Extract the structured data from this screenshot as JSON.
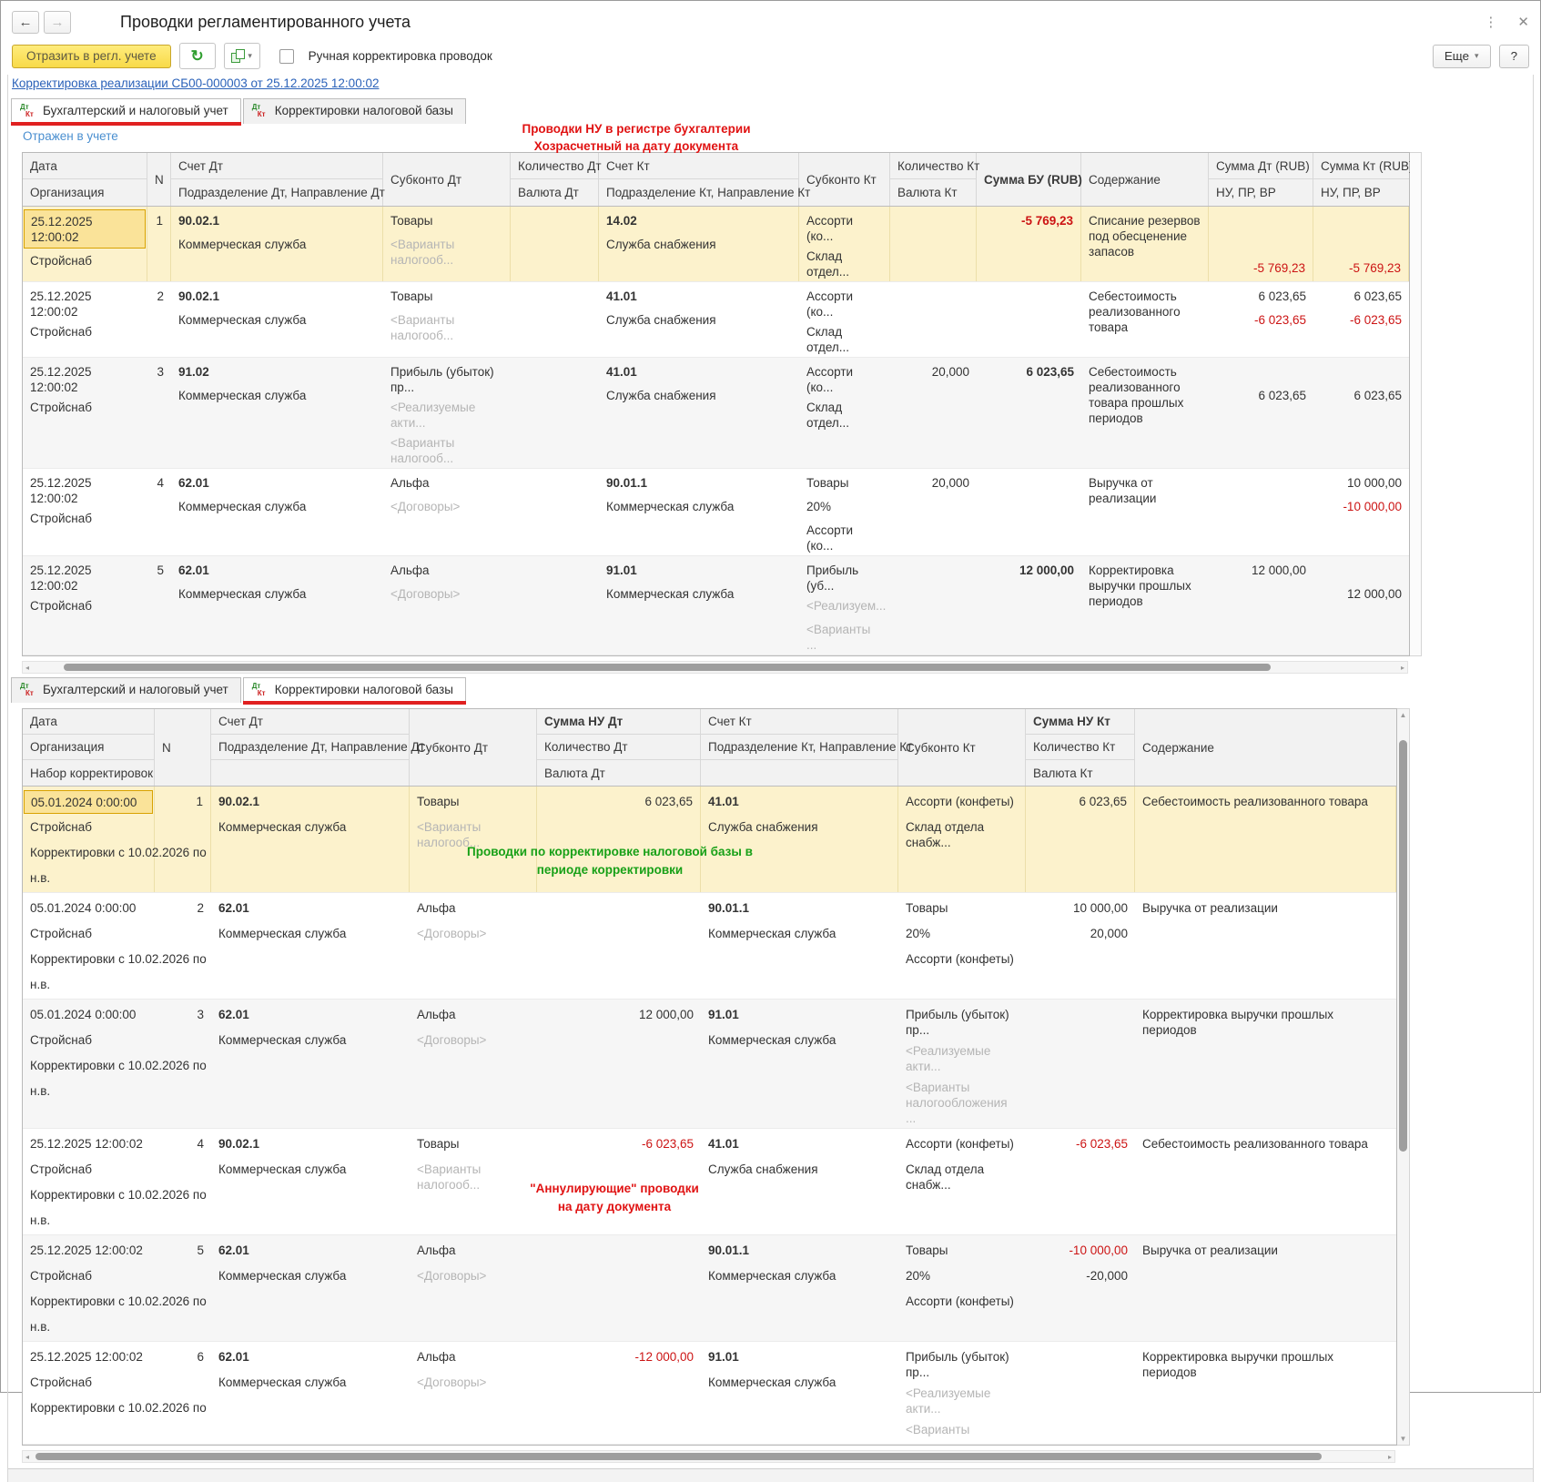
{
  "window": {
    "title": "Проводки регламентированного учета"
  },
  "toolbar": {
    "reflect_button": "Отразить в регл. учете",
    "manual_adjustment_label": "Ручная корректировка проводок",
    "more_button": "Еще",
    "help_button": "?"
  },
  "document_link": "Корректировка реализации СБ00-000003 от 25.12.2025 12:00:02",
  "status_link": "Отражен в учете",
  "tab_icon": {
    "dt": "Дт",
    "kt": "Кт"
  },
  "tabs": {
    "accounting": "Бухгалтерский и налоговый учет",
    "tax_base": "Корректировки налоговой базы"
  },
  "annotations": {
    "top_red": [
      "Проводки НУ в регистре бухгалтерии",
      "Хозрасчетный на дату документа"
    ],
    "green": [
      "Проводки по корректировке налоговой базы в",
      "периоде корректировки"
    ],
    "bottom_red": [
      "\"Аннулирующие\" проводки",
      "на дату документа"
    ]
  },
  "table1": {
    "header": [
      [
        {
          "t": "Дата",
          "r": 1
        },
        {
          "t": "Организация",
          "r": 1
        }
      ],
      [
        {
          "t": "N",
          "r": 2
        }
      ],
      [
        {
          "t": "Счет Дт",
          "r": 1
        },
        {
          "t": "Подразделение Дт, Направление Дт",
          "r": 1
        }
      ],
      [
        {
          "t": "Субконто Дт",
          "r": 2
        }
      ],
      [
        {
          "t": "Количество Дт",
          "r": 1
        },
        {
          "t": "Валюта Дт",
          "r": 1
        }
      ],
      [
        {
          "t": "Счет Кт",
          "r": 1
        },
        {
          "t": "Подразделение Кт, Направление Кт",
          "r": 1
        }
      ],
      [
        {
          "t": "Субконто Кт",
          "r": 2
        }
      ],
      [
        {
          "t": "Количество Кт",
          "r": 1
        },
        {
          "t": "Валюта Кт",
          "r": 1
        }
      ],
      [
        {
          "t": "Сумма БУ (RUB)",
          "r": 2,
          "b": 1
        }
      ],
      [
        {
          "t": "Содержание",
          "r": 2
        }
      ],
      [
        {
          "t": "Сумма Дт (RUB)",
          "r": 1
        },
        {
          "t": "НУ, ПР, ВР",
          "r": 1
        }
      ],
      [
        {
          "t": "Сумма Кт (RUB)",
          "r": 1
        },
        {
          "t": "НУ, ПР, ВР",
          "r": 1
        }
      ]
    ],
    "groups": [
      {
        "box": null,
        "rows": [
          {
            "bg": "sel",
            "selected": true,
            "cells": {
              "date": [
                "25.12.2025 12:00:02",
                "Стройснаб"
              ],
              "n": [
                "1"
              ],
              "acct_dt": [
                {
                  "t": "90.02.1",
                  "s": "b"
                },
                "Коммерческая служба"
              ],
              "sub_dt": [
                "Товары",
                {
                  "t": "<Варианты налогооб...",
                  "s": "g"
                }
              ],
              "qty_dt": [],
              "acct_kt": [
                {
                  "t": "14.02",
                  "s": "b"
                },
                "Служба снабжения"
              ],
              "sub_kt": [
                "Ассорти (ко...",
                "Склад отдел..."
              ],
              "qty_kt": [],
              "sum_bu": [
                {
                  "t": "-5 769,23",
                  "s": "rb"
                }
              ],
              "content": [
                "Списание резервов под обесценение запасов"
              ],
              "sum_dt": [
                null,
                null,
                {
                  "t": "-5 769,23",
                  "s": "r"
                }
              ],
              "sum_kt": [
                null,
                null,
                {
                  "t": "-5 769,23",
                  "s": "r"
                }
              ]
            }
          }
        ]
      },
      {
        "box": "red",
        "rows": [
          {
            "bg": "",
            "cells": {
              "date": [
                "25.12.2025 12:00:02",
                "Стройснаб"
              ],
              "n": [
                "2"
              ],
              "acct_dt": [
                {
                  "t": "90.02.1",
                  "s": "b"
                },
                "Коммерческая служба"
              ],
              "sub_dt": [
                "Товары",
                {
                  "t": "<Варианты налогооб...",
                  "s": "g"
                }
              ],
              "acct_kt": [
                {
                  "t": "41.01",
                  "s": "b"
                },
                "Служба снабжения"
              ],
              "sub_kt": [
                "Ассорти (ко...",
                "Склад отдел..."
              ],
              "content": [
                "Себестоимость реализованного товара"
              ],
              "sum_dt": [
                "6 023,65",
                {
                  "t": "-6 023,65",
                  "s": "r"
                }
              ],
              "sum_kt": [
                "6 023,65",
                {
                  "t": "-6 023,65",
                  "s": "r"
                }
              ]
            }
          }
        ]
      },
      {
        "box": null,
        "rows": [
          {
            "bg": "alt",
            "cells": {
              "date": [
                "25.12.2025 12:00:02",
                "Стройснаб"
              ],
              "n": [
                "3"
              ],
              "acct_dt": [
                {
                  "t": "91.02",
                  "s": "b"
                },
                "Коммерческая служба"
              ],
              "sub_dt": [
                "Прибыль (убыток) пр...",
                {
                  "t": "<Реализуемые акти...",
                  "s": "g"
                },
                {
                  "t": "<Варианты налогооб...",
                  "s": "g"
                }
              ],
              "acct_kt": [
                {
                  "t": "41.01",
                  "s": "b"
                },
                "Служба снабжения"
              ],
              "sub_kt": [
                "Ассорти (ко...",
                "Склад отдел..."
              ],
              "qty_kt": [
                "20,000"
              ],
              "sum_bu": [
                {
                  "t": "6 023,65",
                  "s": "b"
                }
              ],
              "content": [
                "Себестоимость реализованного товара прошлых периодов"
              ],
              "sum_dt": [
                null,
                "6 023,65"
              ],
              "sum_kt": [
                null,
                "6 023,65"
              ]
            }
          }
        ]
      },
      {
        "box": "red",
        "rows": [
          {
            "bg": "",
            "cells": {
              "date": [
                "25.12.2025 12:00:02",
                "Стройснаб"
              ],
              "n": [
                "4"
              ],
              "acct_dt": [
                {
                  "t": "62.01",
                  "s": "b"
                },
                "Коммерческая служба"
              ],
              "sub_dt": [
                "Альфа",
                {
                  "t": "<Договоры>",
                  "s": "g"
                }
              ],
              "acct_kt": [
                {
                  "t": "90.01.1",
                  "s": "b"
                },
                "Коммерческая служба"
              ],
              "sub_kt": [
                "Товары",
                "20%",
                "Ассорти (ко..."
              ],
              "qty_kt": [
                "20,000"
              ],
              "content": [
                "Выручка от реализации"
              ],
              "sum_kt": [
                "10 000,00",
                {
                  "t": "-10 000,00",
                  "s": "r"
                }
              ]
            }
          },
          {
            "bg": "alt",
            "cells": {
              "date": [
                "25.12.2025 12:00:02",
                "Стройснаб"
              ],
              "n": [
                "5"
              ],
              "acct_dt": [
                {
                  "t": "62.01",
                  "s": "b"
                },
                "Коммерческая служба"
              ],
              "sub_dt": [
                "Альфа",
                {
                  "t": "<Договоры>",
                  "s": "g"
                }
              ],
              "acct_kt": [
                {
                  "t": "91.01",
                  "s": "b"
                },
                "Коммерческая служба"
              ],
              "sub_kt": [
                "Прибыль (уб...",
                {
                  "t": "<Реализуем...",
                  "s": "g"
                },
                {
                  "t": "<Варианты ...",
                  "s": "g"
                }
              ],
              "sum_bu": [
                {
                  "t": "12 000,00",
                  "s": "b"
                }
              ],
              "content": [
                "Корректировка выручки прошлых периодов"
              ],
              "sum_dt": [
                "12 000,00"
              ],
              "sum_kt": [
                null,
                "12 000,00"
              ]
            }
          }
        ]
      }
    ]
  },
  "table2": {
    "header": [
      [
        {
          "t": "Дата",
          "r": 1
        },
        {
          "t": "Организация",
          "r": 1
        },
        {
          "t": "Набор корректировок",
          "r": 1
        }
      ],
      [
        {
          "t": "N",
          "r": 3
        }
      ],
      [
        {
          "t": "Счет Дт",
          "r": 1
        },
        {
          "t": "Подразделение Дт, Направление Дт",
          "r": 1
        },
        {
          "t": "",
          "r": 1
        }
      ],
      [
        {
          "t": "Субконто Дт",
          "r": 3
        }
      ],
      [
        {
          "t": "Сумма НУ Дт",
          "r": 1,
          "b": 1
        },
        {
          "t": "Количество Дт",
          "r": 1
        },
        {
          "t": "Валюта Дт",
          "r": 1
        }
      ],
      [
        {
          "t": "Счет Кт",
          "r": 1
        },
        {
          "t": "Подразделение Кт, Направление Кт",
          "r": 1
        },
        {
          "t": "",
          "r": 1
        }
      ],
      [
        {
          "t": "Субконто Кт",
          "r": 3
        }
      ],
      [
        {
          "t": "Сумма НУ Кт",
          "r": 1,
          "b": 1
        },
        {
          "t": "Количество Кт",
          "r": 1
        },
        {
          "t": "Валюта Кт",
          "r": 1
        }
      ],
      [
        {
          "t": "Содержание",
          "r": 3
        }
      ]
    ],
    "groups": [
      {
        "box": "green",
        "rows": [
          {
            "bg": "sel",
            "selected": true,
            "ann": "green",
            "cells": {
              "date": [
                "05.01.2024 0:00:00",
                "Стройснаб",
                "Корректировки с 10.02.2026 по",
                "н.в."
              ],
              "n": [
                "1"
              ],
              "acct_dt": [
                {
                  "t": "90.02.1",
                  "s": "b"
                },
                "Коммерческая служба"
              ],
              "sub_dt": [
                "Товары",
                {
                  "t": "<Варианты налогооб...",
                  "s": "g"
                }
              ],
              "sum_nu_dt": [
                "6 023,65"
              ],
              "acct_kt": [
                {
                  "t": "41.01",
                  "s": "b"
                },
                "Служба снабжения"
              ],
              "sub_kt": [
                "Ассорти (конфеты)",
                "Склад отдела снабж..."
              ],
              "sum_nu_kt": [
                "6 023,65"
              ],
              "content": [
                "Себестоимость реализованного товара"
              ]
            }
          },
          {
            "bg": "",
            "cells": {
              "date": [
                "05.01.2024 0:00:00",
                "Стройснаб",
                "Корректировки с 10.02.2026 по",
                "н.в."
              ],
              "n": [
                "2"
              ],
              "acct_dt": [
                {
                  "t": "62.01",
                  "s": "b"
                },
                "Коммерческая служба"
              ],
              "sub_dt": [
                "Альфа",
                {
                  "t": "<Договоры>",
                  "s": "g"
                }
              ],
              "acct_kt": [
                {
                  "t": "90.01.1",
                  "s": "b"
                },
                "Коммерческая служба"
              ],
              "sub_kt": [
                "Товары",
                "20%",
                "Ассорти (конфеты)"
              ],
              "sum_nu_kt": [
                "10 000,00",
                "20,000"
              ],
              "content": [
                "Выручка от реализации"
              ]
            }
          },
          {
            "bg": "alt",
            "cells": {
              "date": [
                "05.01.2024 0:00:00",
                "Стройснаб",
                "Корректировки с 10.02.2026 по",
                "н.в."
              ],
              "n": [
                "3"
              ],
              "acct_dt": [
                {
                  "t": "62.01",
                  "s": "b"
                },
                "Коммерческая служба"
              ],
              "sub_dt": [
                "Альфа",
                {
                  "t": "<Договоры>",
                  "s": "g"
                }
              ],
              "sum_nu_dt": [
                "12 000,00"
              ],
              "acct_kt": [
                {
                  "t": "91.01",
                  "s": "b"
                },
                "Коммерческая служба"
              ],
              "sub_kt": [
                "Прибыль (убыток) пр...",
                {
                  "t": "<Реализуемые акти...",
                  "s": "g"
                },
                {
                  "t": "<Варианты налогообложения ...",
                  "s": "g"
                }
              ],
              "content": [
                "Корректировка выручки прошлых периодов"
              ]
            }
          }
        ]
      },
      {
        "box": "red",
        "rows": [
          {
            "bg": "",
            "ann": "red",
            "cells": {
              "date": [
                "25.12.2025 12:00:02",
                "Стройснаб",
                "Корректировки с 10.02.2026 по",
                "н.в."
              ],
              "n": [
                "4"
              ],
              "acct_dt": [
                {
                  "t": "90.02.1",
                  "s": "b"
                },
                "Коммерческая служба"
              ],
              "sub_dt": [
                "Товары",
                {
                  "t": "<Варианты налогооб...",
                  "s": "g"
                }
              ],
              "sum_nu_dt": [
                {
                  "t": "-6 023,65",
                  "s": "r"
                }
              ],
              "acct_kt": [
                {
                  "t": "41.01",
                  "s": "b"
                },
                "Служба снабжения"
              ],
              "sub_kt": [
                "Ассорти (конфеты)",
                "Склад отдела снабж..."
              ],
              "sum_nu_kt": [
                {
                  "t": "-6 023,65",
                  "s": "r"
                }
              ],
              "content": [
                "Себестоимость реализованного товара"
              ]
            }
          },
          {
            "bg": "alt",
            "cells": {
              "date": [
                "25.12.2025 12:00:02",
                "Стройснаб",
                "Корректировки с 10.02.2026 по",
                "н.в."
              ],
              "n": [
                "5"
              ],
              "acct_dt": [
                {
                  "t": "62.01",
                  "s": "b"
                },
                "Коммерческая служба"
              ],
              "sub_dt": [
                "Альфа",
                {
                  "t": "<Договоры>",
                  "s": "g"
                }
              ],
              "acct_kt": [
                {
                  "t": "90.01.1",
                  "s": "b"
                },
                "Коммерческая служба"
              ],
              "sub_kt": [
                "Товары",
                "20%",
                "Ассорти (конфеты)"
              ],
              "sum_nu_kt": [
                {
                  "t": "-10 000,00",
                  "s": "r"
                },
                "-20,000"
              ],
              "content": [
                "Выручка от реализации"
              ]
            }
          },
          {
            "bg": "",
            "cells": {
              "date": [
                "25.12.2025 12:00:02",
                "Стройснаб",
                "Корректировки с 10.02.2026 по"
              ],
              "n": [
                "6"
              ],
              "acct_dt": [
                {
                  "t": "62.01",
                  "s": "b"
                },
                "Коммерческая служба"
              ],
              "sub_dt": [
                "Альфа",
                {
                  "t": "<Договоры>",
                  "s": "g"
                }
              ],
              "sum_nu_dt": [
                {
                  "t": "-12 000,00",
                  "s": "r"
                }
              ],
              "acct_kt": [
                {
                  "t": "91.01",
                  "s": "b"
                },
                "Коммерческая служба"
              ],
              "sub_kt": [
                "Прибыль (убыток) пр...",
                {
                  "t": "<Реализуемые акти...",
                  "s": "g"
                },
                {
                  "t": "<Варианты",
                  "s": "g"
                }
              ],
              "content": [
                "Корректировка выручки прошлых периодов"
              ]
            }
          }
        ]
      }
    ]
  }
}
